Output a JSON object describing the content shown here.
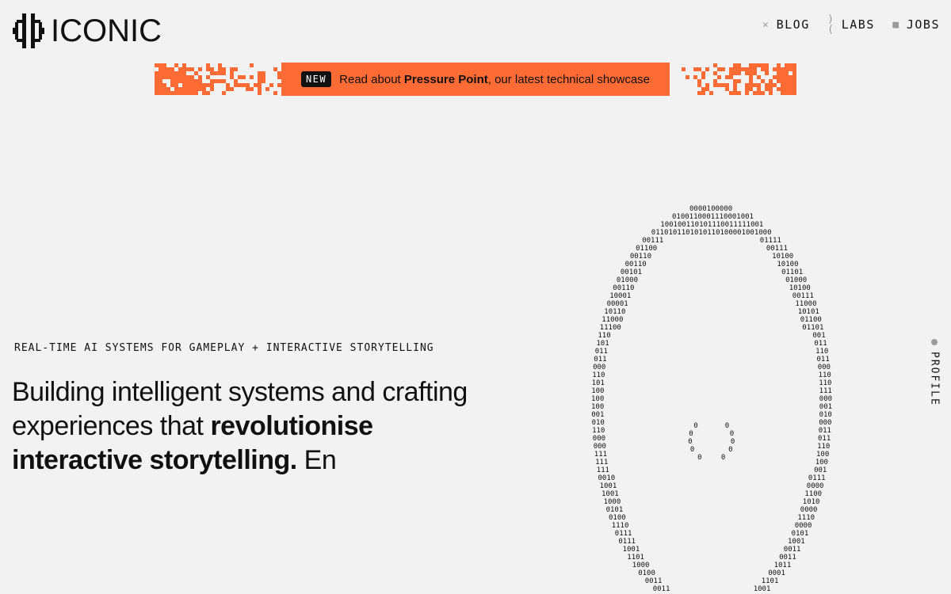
{
  "brand": {
    "name": "ICONIC",
    "logo_icon": "iconic-logo-mark"
  },
  "nav": {
    "items": [
      {
        "label": "BLOG",
        "icon": "x-icon"
      },
      {
        "label": "LABS",
        "icon": "iconic-mini-icon"
      },
      {
        "label": "JOBS",
        "icon": "square-icon"
      }
    ]
  },
  "banner": {
    "badge": "NEW",
    "text_before": "Read about ",
    "highlight": "Pressure Point",
    "text_after": ", our latest technical showcase"
  },
  "hero": {
    "eyebrow": "REAL-TIME AI SYSTEMS FOR GAMEPLAY + INTERACTIVE STORYTELLING",
    "headline_part1": "Building intelligent systems and crafting experiences that ",
    "headline_strong": "revolutionise interactive storytelling.",
    "headline_part2": " En"
  },
  "side_tab": {
    "label": "PROFILE"
  },
  "colors": {
    "background": "#f2f2f2",
    "accent": "#ff6b35",
    "text": "#111111",
    "muted": "#9a9a9a"
  }
}
